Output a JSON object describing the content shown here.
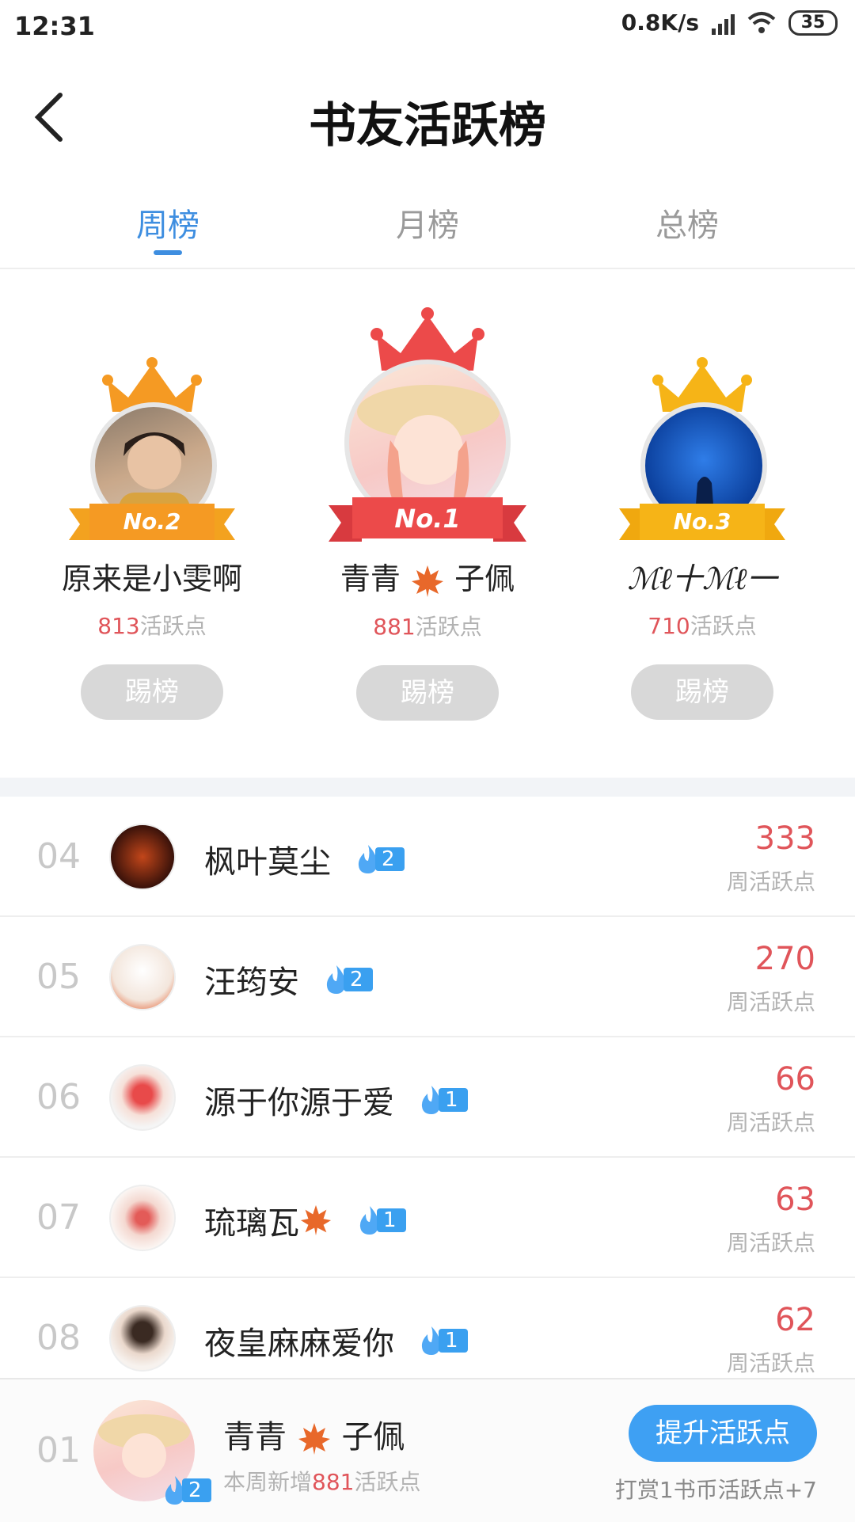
{
  "status_bar": {
    "time": "12:31",
    "net_speed": "0.8K/s",
    "battery": "35"
  },
  "header": {
    "title": "书友活跃榜"
  },
  "tabs": [
    {
      "label": "周榜"
    },
    {
      "label": "月榜"
    },
    {
      "label": "总榜"
    }
  ],
  "podium": {
    "first": {
      "badge": "No.1",
      "name_a": "青青",
      "name_b": "子佩",
      "points": "881",
      "points_unit": "活跃点",
      "button": "踢榜"
    },
    "second": {
      "badge": "No.2",
      "name": "原来是小雯啊",
      "points": "813",
      "points_unit": "活跃点",
      "button": "踢榜"
    },
    "third": {
      "badge": "No.3",
      "name": "ℳℓ十ℳℓ一",
      "points": "710",
      "points_unit": "活跃点",
      "button": "踢榜"
    }
  },
  "rankings": [
    {
      "rank": "04",
      "name": "枫叶莫尘",
      "level": "2",
      "score": "333",
      "score_label": "周活跃点"
    },
    {
      "rank": "05",
      "name": "汪筠安",
      "level": "2",
      "score": "270",
      "score_label": "周活跃点"
    },
    {
      "rank": "06",
      "name": "源于你源于爱",
      "level": "1",
      "score": "66",
      "score_label": "周活跃点"
    },
    {
      "rank": "07",
      "name": "琉璃瓦",
      "level": "1",
      "score": "63",
      "score_label": "周活跃点"
    },
    {
      "rank": "08",
      "name": "夜皇麻麻爱你",
      "level": "1",
      "score": "62",
      "score_label": "周活跃点"
    }
  ],
  "footer": {
    "rank": "01",
    "name_a": "青青",
    "name_b": "子佩",
    "level": "2",
    "sub_prefix": "本周新增",
    "sub_points": "881",
    "sub_suffix": "活跃点",
    "button": "提升活跃点",
    "tip": "打赏1书币活跃点+7"
  },
  "colors": {
    "accent": "#3e8ee0",
    "points": "#e0555a",
    "gold": "#f6b417",
    "orange": "#f59a23",
    "red": "#e8474c"
  }
}
